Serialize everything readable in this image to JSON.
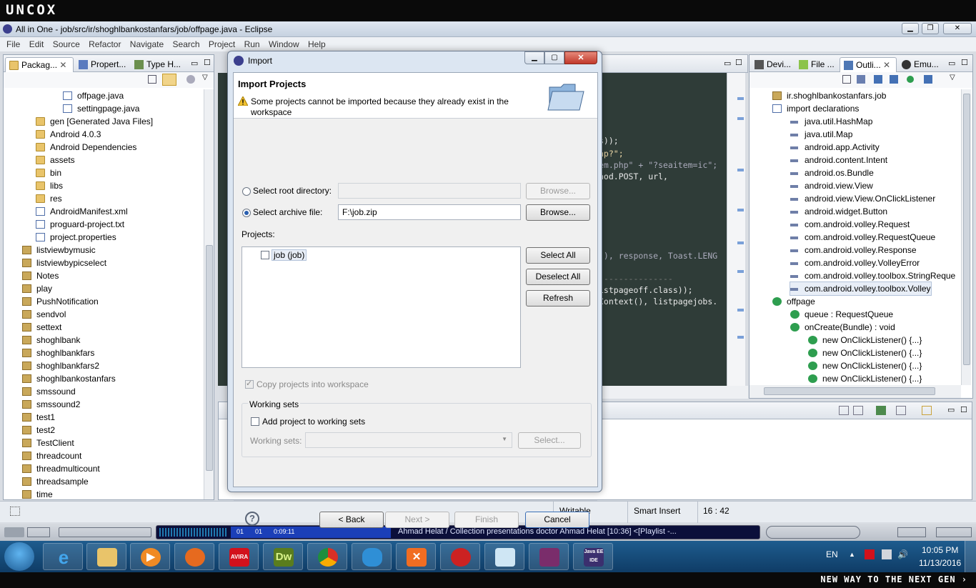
{
  "brand": {
    "logo_text": "UNCOX",
    "footer_tag": "NEW WAY TO THE NEXT GEN ›"
  },
  "window": {
    "title": "All in One - job/src/ir/shoghlbankostanfars/job/offpage.java - Eclipse"
  },
  "menu": [
    "File",
    "Edit",
    "Source",
    "Refactor",
    "Navigate",
    "Search",
    "Project",
    "Run",
    "Window",
    "Help"
  ],
  "left_panel": {
    "tabs": [
      "Packag...",
      "Propert...",
      "Type H..."
    ],
    "tree": [
      {
        "label": "offpage.java",
        "indent": 3,
        "icon": "java-file-icon"
      },
      {
        "label": "settingpage.java",
        "indent": 3,
        "icon": "java-file-icon"
      },
      {
        "label": "gen [Generated Java Files]",
        "indent": 1,
        "icon": "folder-icon"
      },
      {
        "label": "Android 4.0.3",
        "indent": 1,
        "icon": "library-icon"
      },
      {
        "label": "Android Dependencies",
        "indent": 1,
        "icon": "library-icon"
      },
      {
        "label": "assets",
        "indent": 1,
        "icon": "folder-icon"
      },
      {
        "label": "bin",
        "indent": 1,
        "icon": "folder-icon"
      },
      {
        "label": "libs",
        "indent": 1,
        "icon": "folder-icon"
      },
      {
        "label": "res",
        "indent": 1,
        "icon": "folder-icon"
      },
      {
        "label": "AndroidManifest.xml",
        "indent": 1,
        "icon": "xml-file-icon"
      },
      {
        "label": "proguard-project.txt",
        "indent": 1,
        "icon": "text-file-icon"
      },
      {
        "label": "project.properties",
        "indent": 1,
        "icon": "text-file-icon"
      },
      {
        "label": "listviewbymusic",
        "indent": 0,
        "icon": "project-icon"
      },
      {
        "label": "listviewbypicselect",
        "indent": 0,
        "icon": "project-icon"
      },
      {
        "label": "Notes",
        "indent": 0,
        "icon": "project-icon"
      },
      {
        "label": "play",
        "indent": 0,
        "icon": "project-icon"
      },
      {
        "label": "PushNotification",
        "indent": 0,
        "icon": "project-icon"
      },
      {
        "label": "sendvol",
        "indent": 0,
        "icon": "project-icon"
      },
      {
        "label": "settext",
        "indent": 0,
        "icon": "project-icon"
      },
      {
        "label": "shoghlbank",
        "indent": 0,
        "icon": "project-icon"
      },
      {
        "label": "shoghlbankfars",
        "indent": 0,
        "icon": "project-icon"
      },
      {
        "label": "shoghlbankfars2",
        "indent": 0,
        "icon": "project-icon"
      },
      {
        "label": "shoghlbankostanfars",
        "indent": 0,
        "icon": "project-icon"
      },
      {
        "label": "smssound",
        "indent": 0,
        "icon": "project-icon"
      },
      {
        "label": "smssound2",
        "indent": 0,
        "icon": "project-icon"
      },
      {
        "label": "test1",
        "indent": 0,
        "icon": "project-icon"
      },
      {
        "label": "test2",
        "indent": 0,
        "icon": "project-icon"
      },
      {
        "label": "TestClient",
        "indent": 0,
        "icon": "project-icon"
      },
      {
        "label": "threadcount",
        "indent": 0,
        "icon": "project-icon"
      },
      {
        "label": "threadmulticount",
        "indent": 0,
        "icon": "project-icon"
      },
      {
        "label": "threadsample",
        "indent": 0,
        "icon": "project-icon"
      },
      {
        "label": "time",
        "indent": 0,
        "icon": "project-icon"
      }
    ]
  },
  "code_fragments": [
    "s));",
    "hp?\";",
    "em.php\" + \"?seaitem=ic\";",
    "hod.POST, url,",
    "(), response, Toast.LENG",
    "---------------",
    "istpageoff.class));",
    "Context(), listpagejobs."
  ],
  "right_panel": {
    "tabs": [
      "Devi...",
      "File ...",
      "Outli...",
      "Emu..."
    ],
    "tree": [
      {
        "label": "ir.shoghlbankostanfars.job",
        "indent": 0,
        "icon": "package-icon"
      },
      {
        "label": "import declarations",
        "indent": 0,
        "icon": "imports-icon"
      },
      {
        "label": "java.util.HashMap",
        "indent": 1,
        "icon": "import-icon"
      },
      {
        "label": "java.util.Map",
        "indent": 1,
        "icon": "import-icon"
      },
      {
        "label": "android.app.Activity",
        "indent": 1,
        "icon": "import-icon"
      },
      {
        "label": "android.content.Intent",
        "indent": 1,
        "icon": "import-icon"
      },
      {
        "label": "android.os.Bundle",
        "indent": 1,
        "icon": "import-icon"
      },
      {
        "label": "android.view.View",
        "indent": 1,
        "icon": "import-icon"
      },
      {
        "label": "android.view.View.OnClickListener",
        "indent": 1,
        "icon": "import-icon"
      },
      {
        "label": "android.widget.Button",
        "indent": 1,
        "icon": "import-icon"
      },
      {
        "label": "com.android.volley.Request",
        "indent": 1,
        "icon": "import-icon"
      },
      {
        "label": "com.android.volley.RequestQueue",
        "indent": 1,
        "icon": "import-icon"
      },
      {
        "label": "com.android.volley.Response",
        "indent": 1,
        "icon": "import-icon"
      },
      {
        "label": "com.android.volley.VolleyError",
        "indent": 1,
        "icon": "import-icon"
      },
      {
        "label": "com.android.volley.toolbox.StringReque",
        "indent": 1,
        "icon": "import-icon"
      },
      {
        "label": "com.android.volley.toolbox.Volley",
        "indent": 1,
        "icon": "import-icon"
      },
      {
        "label": "offpage",
        "indent": 0,
        "icon": "class-icon"
      },
      {
        "label": "queue : RequestQueue",
        "indent": 1,
        "icon": "field-icon"
      },
      {
        "label": "onCreate(Bundle) : void",
        "indent": 1,
        "icon": "method-icon"
      },
      {
        "label": "new OnClickListener() {...}",
        "indent": 2,
        "icon": "anon-class-icon"
      },
      {
        "label": "new OnClickListener() {...}",
        "indent": 2,
        "icon": "anon-class-icon"
      },
      {
        "label": "new OnClickListener() {...}",
        "indent": 2,
        "icon": "anon-class-icon"
      },
      {
        "label": "new OnClickListener() {...}",
        "indent": 2,
        "icon": "anon-class-icon"
      }
    ]
  },
  "dialog": {
    "title": "Import",
    "header_title": "Import Projects",
    "warning": "Some projects cannot be imported because they already exist in the workspace",
    "root_dir_label": "Select root directory:",
    "root_dir_value": "",
    "archive_label": "Select archive file:",
    "archive_value": "F:\\job.zip",
    "browse_label": "Browse...",
    "projects_label": "Projects:",
    "project_item": "job (job)",
    "select_all": "Select All",
    "deselect_all": "Deselect All",
    "refresh": "Refresh",
    "copy_label": "Copy projects into workspace",
    "working_sets_group": "Working sets",
    "add_to_ws_label": "Add project to working sets",
    "working_sets_label": "Working sets:",
    "select_ws": "Select...",
    "back": "< Back",
    "next": "Next >",
    "finish": "Finish",
    "cancel": "Cancel"
  },
  "status": {
    "writable": "Writable",
    "insert": "Smart Insert",
    "position": "16 : 42"
  },
  "media": {
    "counter1": "01",
    "counter2": "01",
    "time": "0:09:11",
    "now_playing": "Ahmad Helat / Collection presentations doctor Ahmad Helat  [10:36]    <[Playlist -..."
  },
  "tray": {
    "lang": "EN",
    "time": "10:05 PM",
    "date": "11/13/2016"
  },
  "taskbar_apps": [
    "start-orb",
    "internet-explorer",
    "file-explorer",
    "media-player",
    "firefox",
    "avira",
    "dreamweaver",
    "chrome",
    "security-shield",
    "xampp",
    "filezilla",
    "notepad",
    "winrar",
    "java-ee-ide"
  ],
  "taskbar_labels": {
    "avira": "AVIRA",
    "dreamweaver": "Dw",
    "javaee": "Java EE IDE"
  }
}
